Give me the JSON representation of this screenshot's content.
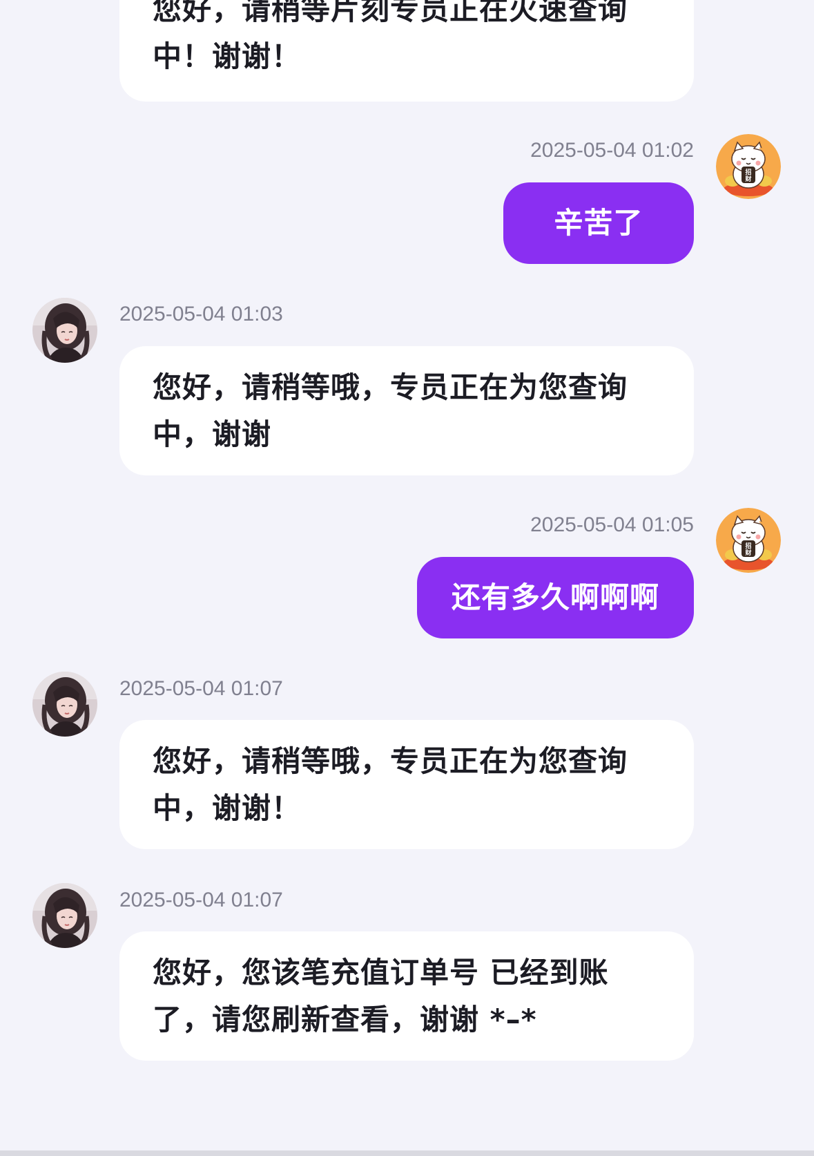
{
  "messages": [
    {
      "direction": "in",
      "lines": [
        "您好，请稍等片刻专员正在火速查询",
        "中！谢谢！"
      ]
    },
    {
      "direction": "out",
      "timestamp": "2025-05-04 01:02",
      "lines": [
        "辛苦了"
      ]
    },
    {
      "direction": "in",
      "timestamp": "2025-05-04 01:03",
      "lines": [
        "您好，请稍等哦，专员正在为您查询",
        "中，谢谢"
      ]
    },
    {
      "direction": "out",
      "timestamp": "2025-05-04 01:05",
      "lines": [
        "还有多久啊啊啊"
      ]
    },
    {
      "direction": "in",
      "timestamp": "2025-05-04 01:07",
      "lines": [
        "您好，请稍等哦，专员正在为您查询",
        "中，谢谢！"
      ]
    },
    {
      "direction": "in",
      "timestamp": "2025-05-04 01:07",
      "lines": [
        "您好，您该笔充值订单号 已经到账",
        "了，请您刷新查看，谢谢 *–*"
      ]
    }
  ],
  "avatars": {
    "agent": "agent-photo-avatar",
    "user": "lucky-cat-avatar",
    "user_badge_text": "招财"
  },
  "colors": {
    "background": "#f3f3fa",
    "incoming_bubble": "#ffffff",
    "outgoing_bubble": "#8a2ff2",
    "timestamp": "#80808f",
    "text": "#1c1c24"
  }
}
